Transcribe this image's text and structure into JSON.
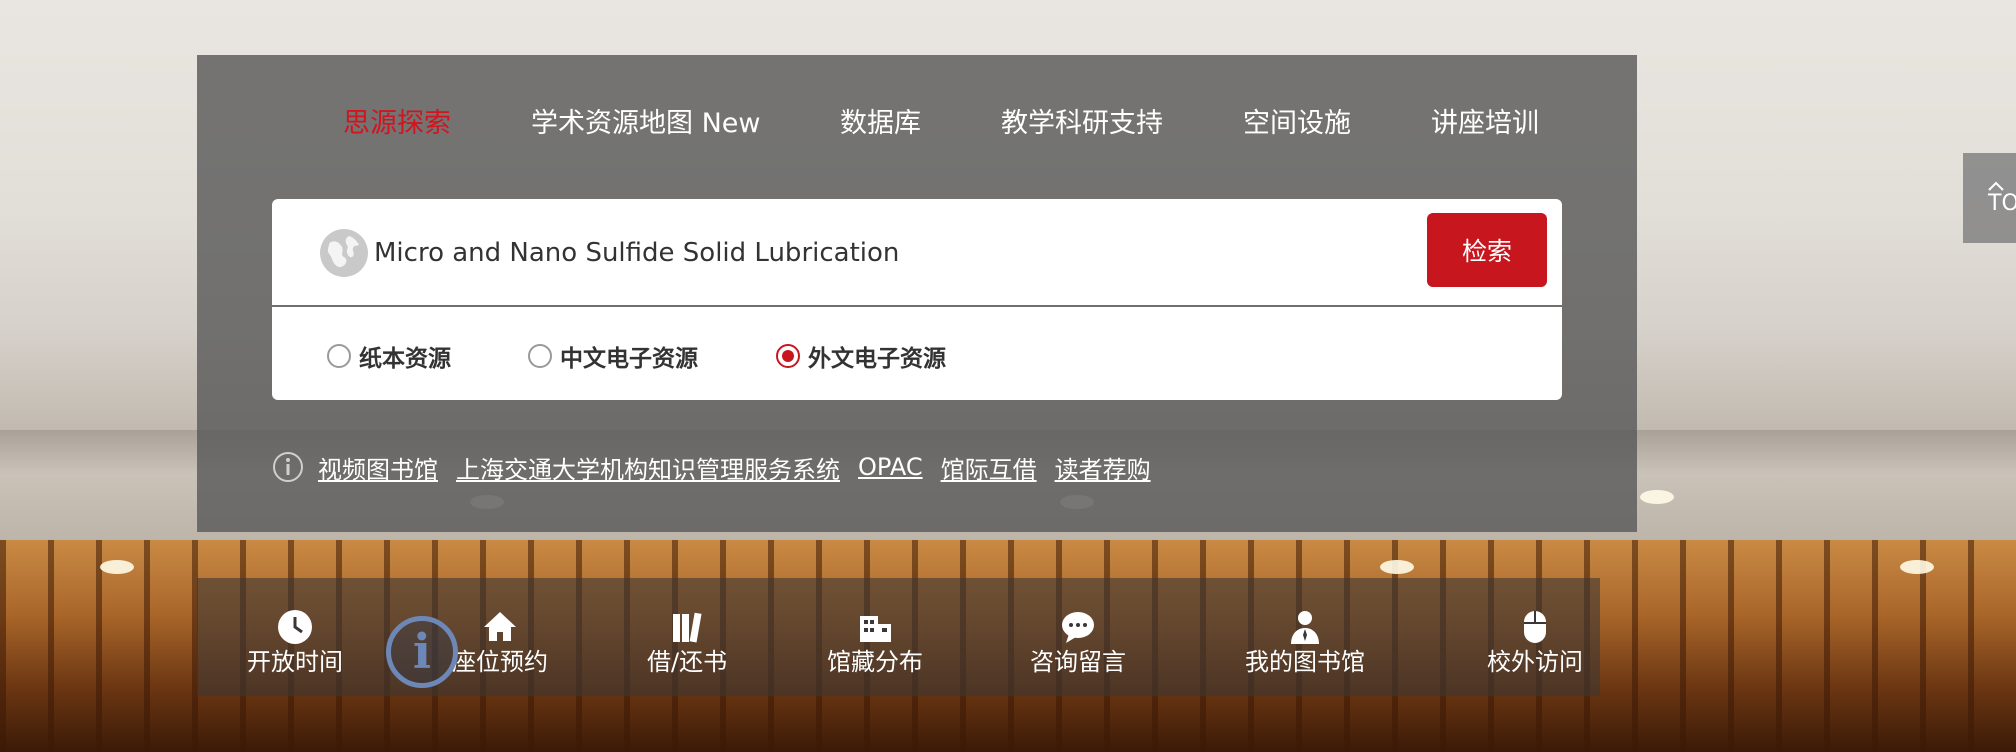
{
  "nav": {
    "tabs": [
      {
        "label": "思源探索",
        "active": true
      },
      {
        "label": "学术资源地图 New",
        "active": false
      },
      {
        "label": "数据库",
        "active": false
      },
      {
        "label": "教学科研支持",
        "active": false
      },
      {
        "label": "空间设施",
        "active": false
      },
      {
        "label": "讲座培训",
        "active": false
      }
    ]
  },
  "search": {
    "value": "Micro and Nano Sulfide Solid Lubrication",
    "button_label": "检索",
    "icon": "globe-icon"
  },
  "resource_types": [
    {
      "label": "纸本资源",
      "checked": false
    },
    {
      "label": "中文电子资源",
      "checked": false
    },
    {
      "label": "外文电子资源",
      "checked": true
    }
  ],
  "quick_links": {
    "icon": "info-icon",
    "items": [
      "视频图书馆",
      "上海交通大学机构知识管理服务系统",
      "OPAC",
      "馆际互借",
      "读者荐购"
    ]
  },
  "services": [
    {
      "label": "开放时间",
      "icon": "clock-icon"
    },
    {
      "label": "座位预约",
      "icon": "home-icon"
    },
    {
      "label": "借/还书",
      "icon": "books-icon"
    },
    {
      "label": "馆藏分布",
      "icon": "building-icon"
    },
    {
      "label": "咨询留言",
      "icon": "chat-icon"
    },
    {
      "label": "我的图书馆",
      "icon": "user-icon"
    },
    {
      "label": "校外访问",
      "icon": "mouse-icon"
    }
  ],
  "back_to_top": {
    "label": "TO"
  },
  "colors": {
    "accent": "#c8161e",
    "panel": "#5a5a5a"
  }
}
